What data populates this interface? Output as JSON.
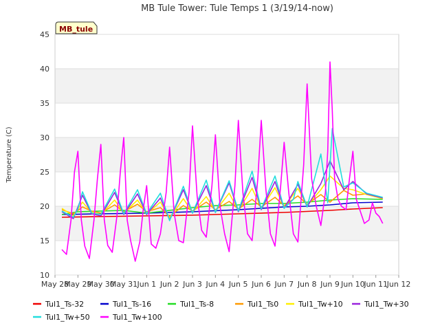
{
  "chart_data": {
    "type": "line",
    "title": "MB Tule Tower: Tule Temps 1 (3/19/14-now)",
    "xlabel": "",
    "ylabel": "Temperature (C)",
    "ylim": [
      10,
      45
    ],
    "yticks": [
      10,
      15,
      20,
      25,
      30,
      35,
      40,
      45
    ],
    "xlim": [
      0,
      15
    ],
    "xticks": [
      {
        "v": 0,
        "label": "May 28"
      },
      {
        "v": 1,
        "label": "May 29"
      },
      {
        "v": 2,
        "label": "May 30"
      },
      {
        "v": 3,
        "label": "May 31"
      },
      {
        "v": 4,
        "label": "Jun 1"
      },
      {
        "v": 5,
        "label": "Jun 2"
      },
      {
        "v": 6,
        "label": "Jun 3"
      },
      {
        "v": 7,
        "label": "Jun 4"
      },
      {
        "v": 8,
        "label": "Jun 5"
      },
      {
        "v": 9,
        "label": "Jun 6"
      },
      {
        "v": 10,
        "label": "Jun 7"
      },
      {
        "v": 11,
        "label": "Jun 8"
      },
      {
        "v": 12,
        "label": "Jun 9"
      },
      {
        "v": 13,
        "label": "Jun 10"
      },
      {
        "v": 14,
        "label": "Jun 11"
      },
      {
        "v": 15,
        "label": "Jun 12"
      }
    ],
    "grid": true,
    "legend_position": "bottom",
    "station_badge": "MB_tule",
    "series": [
      {
        "name": "Tul1_Ts-32",
        "color": "#ee0000",
        "x": [
          0.3,
          2,
          4,
          6,
          8,
          10,
          12,
          13,
          14.3
        ],
        "y": [
          18.4,
          18.5,
          18.6,
          18.7,
          18.9,
          19.1,
          19.4,
          19.6,
          19.8
        ]
      },
      {
        "name": "Tul1_Ts-16",
        "color": "#0000cc",
        "x": [
          0.3,
          2,
          4,
          6,
          8,
          10,
          11,
          12,
          13,
          14.3
        ],
        "y": [
          18.8,
          18.9,
          19.0,
          19.2,
          19.5,
          19.9,
          20.0,
          20.2,
          20.5,
          20.6
        ]
      },
      {
        "name": "Tul1_Ts-8",
        "color": "#22dd22",
        "x": [
          0.3,
          1,
          2,
          3,
          4,
          5,
          6,
          7,
          8,
          9,
          10,
          11,
          12,
          13,
          14.3
        ],
        "y": [
          18.8,
          19.2,
          19.3,
          19.4,
          19.0,
          19.4,
          19.8,
          20.1,
          20.2,
          20.4,
          20.4,
          20.6,
          20.9,
          21.1,
          21.0
        ]
      },
      {
        "name": "Tul1_Ts0",
        "color": "#ff9900",
        "x": [
          0.3,
          0.8,
          1.2,
          1.6,
          2.0,
          2.6,
          3.0,
          3.6,
          4.0,
          4.6,
          5.0,
          5.6,
          6.0,
          6.6,
          7.0,
          7.6,
          8.0,
          8.6,
          9.0,
          9.6,
          10.0,
          10.6,
          11.0,
          11.6,
          12.0,
          12.6,
          13.0,
          13.6,
          14.3
        ],
        "y": [
          19.5,
          18.9,
          19.9,
          19.3,
          19.0,
          20.2,
          19.2,
          20.3,
          19.2,
          19.8,
          18.5,
          20.1,
          19.3,
          20.6,
          19.5,
          20.7,
          19.6,
          21.0,
          19.9,
          21.3,
          20.1,
          21.5,
          20.3,
          21.7,
          20.6,
          22.3,
          21.6,
          21.8,
          21.1
        ]
      },
      {
        "name": "Tul1_Tw+10",
        "color": "#ffee00",
        "x": [
          0.3,
          0.8,
          1.2,
          1.6,
          2.0,
          2.6,
          3.0,
          3.6,
          4.0,
          4.6,
          5.0,
          5.6,
          6.0,
          6.6,
          7.0,
          7.6,
          8.0,
          8.6,
          9.0,
          9.6,
          10.0,
          10.6,
          11.0,
          11.6,
          12.0,
          12.6,
          13.0,
          13.6,
          14.3
        ],
        "y": [
          19.7,
          18.6,
          20.6,
          19.1,
          18.8,
          20.9,
          19.0,
          20.9,
          18.9,
          20.6,
          18.3,
          21.1,
          19.1,
          21.4,
          19.3,
          21.9,
          19.4,
          22.6,
          19.7,
          22.7,
          19.9,
          22.6,
          20.1,
          22.4,
          24.4,
          22.6,
          22.4,
          21.7,
          21.1
        ]
      },
      {
        "name": "Tul1_Tw+30",
        "color": "#9922dd",
        "x": [
          0.3,
          0.8,
          1.2,
          1.6,
          2.0,
          2.6,
          3.0,
          3.6,
          4.0,
          4.6,
          5.0,
          5.6,
          6.0,
          6.6,
          7.0,
          7.6,
          8.0,
          8.6,
          9.0,
          9.6,
          10.0,
          10.6,
          11.0,
          11.6,
          12.0,
          12.6,
          13.0,
          13.6,
          14.3
        ],
        "y": [
          19.2,
          18.2,
          21.6,
          18.9,
          18.6,
          22.0,
          18.8,
          21.8,
          18.8,
          21.2,
          18.0,
          22.4,
          19.0,
          23.0,
          19.1,
          23.4,
          19.2,
          24.2,
          19.5,
          23.6,
          19.7,
          23.2,
          19.9,
          23.3,
          26.6,
          22.4,
          23.6,
          21.8,
          21.2
        ]
      },
      {
        "name": "Tul1_Tw+50",
        "color": "#22dddd",
        "x": [
          0.3,
          0.8,
          1.0,
          1.2,
          1.6,
          2.0,
          2.6,
          3.0,
          3.6,
          4.0,
          4.6,
          5.0,
          5.6,
          6.0,
          6.6,
          7.0,
          7.6,
          8.0,
          8.6,
          9.0,
          9.6,
          10.0,
          10.4,
          10.6,
          11.0,
          11.6,
          11.9,
          12.1,
          12.6,
          13.0,
          13.6,
          14.3
        ],
        "y": [
          19.3,
          18.4,
          19.6,
          22.1,
          19.0,
          18.8,
          22.5,
          18.9,
          22.4,
          18.9,
          21.9,
          17.9,
          22.9,
          19.0,
          23.8,
          19.1,
          23.7,
          19.3,
          25.1,
          19.6,
          24.4,
          19.7,
          21.0,
          23.6,
          19.9,
          27.6,
          20.5,
          31.3,
          22.8,
          23.4,
          21.9,
          21.3
        ]
      },
      {
        "name": "Tul1_Tw+100",
        "color": "#ff00ff",
        "x": [
          0.3,
          0.5,
          0.7,
          0.85,
          1.0,
          1.15,
          1.3,
          1.5,
          1.7,
          1.85,
          2.0,
          2.15,
          2.3,
          2.5,
          2.7,
          2.85,
          3.0,
          3.15,
          3.3,
          3.5,
          3.7,
          3.85,
          4.0,
          4.2,
          4.4,
          4.6,
          4.85,
          5.0,
          5.2,
          5.4,
          5.6,
          5.85,
          6.0,
          6.2,
          6.4,
          6.6,
          6.85,
          7.0,
          7.2,
          7.4,
          7.6,
          7.85,
          8.0,
          8.2,
          8.4,
          8.6,
          8.85,
          9.0,
          9.2,
          9.4,
          9.6,
          9.85,
          10.0,
          10.2,
          10.4,
          10.6,
          10.85,
          11.0,
          11.2,
          11.4,
          11.6,
          11.8,
          11.9,
          12.0,
          12.1,
          12.2,
          12.35,
          12.5,
          12.7,
          12.85,
          13.0,
          13.15,
          13.3,
          13.5,
          13.7,
          13.85,
          14.0,
          14.15,
          14.3
        ],
        "y": [
          13.7,
          13.0,
          18.0,
          25.0,
          28.0,
          18.0,
          14.2,
          12.4,
          18.0,
          24.0,
          29.0,
          18.0,
          14.3,
          13.3,
          18.5,
          25.0,
          30.0,
          18.0,
          15.0,
          12.0,
          14.8,
          19.5,
          23.0,
          14.5,
          13.9,
          16.0,
          22.0,
          28.6,
          19.0,
          15.0,
          14.7,
          22.0,
          31.7,
          21.5,
          16.5,
          15.5,
          23.0,
          30.4,
          20.0,
          16.0,
          13.4,
          23.0,
          32.5,
          22.0,
          16.0,
          15.0,
          24.0,
          32.5,
          22.5,
          16.0,
          14.2,
          23.0,
          29.3,
          22.0,
          16.0,
          14.8,
          26.0,
          37.8,
          24.0,
          20.0,
          17.2,
          22.0,
          28.0,
          41.0,
          34.0,
          24.0,
          21.0,
          20.0,
          19.5,
          24.0,
          28.0,
          21.0,
          19.5,
          17.5,
          18.0,
          20.5,
          19.0,
          18.5,
          17.5
        ]
      }
    ]
  }
}
